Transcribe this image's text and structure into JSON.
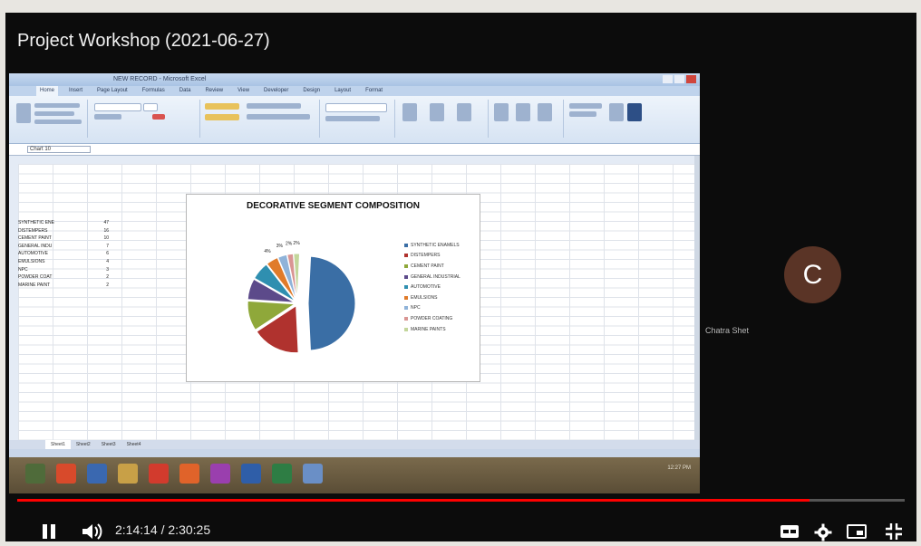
{
  "video": {
    "title": "Project Workshop (2021-06-27)",
    "time_current": "2:14:14",
    "time_separator": " / ",
    "time_total": "2:30:25",
    "progress_fraction": 0.893,
    "accent_color": "#ff0000"
  },
  "participant": {
    "initial": "C",
    "name": "Chatra Shet"
  },
  "excel": {
    "window_title": "NEW RECORD - Microsoft Excel",
    "ribbon_tabs": [
      "Home",
      "Insert",
      "Page Layout",
      "Formulas",
      "Data",
      "Review",
      "View",
      "Developer",
      "Design",
      "Layout",
      "Format"
    ],
    "active_tab": "Home",
    "name_box": "Chart 10",
    "rows": [
      {
        "label": "SYNTHETIC ENE",
        "value": "47"
      },
      {
        "label": "DISTEMPERS",
        "value": "16"
      },
      {
        "label": "CEMENT PAINT",
        "value": "10"
      },
      {
        "label": "GENERAL INDU",
        "value": "7"
      },
      {
        "label": "AUTOMOTIVE",
        "value": "6"
      },
      {
        "label": "EMULSIONS",
        "value": "4"
      },
      {
        "label": "NPC",
        "value": "3"
      },
      {
        "label": "POWDER COAT",
        "value": "2"
      },
      {
        "label": "MARINE PAINT",
        "value": "2"
      }
    ],
    "sheet_tabs": [
      "Sheet1",
      "Sheet2",
      "Sheet3",
      "Sheet4"
    ],
    "tray_time": "12:27 PM"
  },
  "chart_data": {
    "type": "pie",
    "title": "DECORATIVE SEGMENT COMPOSITION",
    "categories": [
      "SYNTHETIC ENAMELS",
      "DISTEMPERS",
      "CEMENT PAINT",
      "GENERAL INDUSTRIAL",
      "AUTOMOTIVE",
      "EMULSIONS",
      "NPC",
      "POWDER COATING",
      "MARINE PAINTS"
    ],
    "values": [
      47,
      16,
      10,
      7,
      6,
      4,
      3,
      2,
      2
    ],
    "colors": [
      "#3a6ea5",
      "#b0322e",
      "#8fa83a",
      "#5c4a8a",
      "#2f8fb0",
      "#e07b2a",
      "#8fb3d9",
      "#d99593",
      "#c3d69b"
    ],
    "data_labels": [
      "",
      "",
      "",
      "",
      "",
      "4%",
      "3%",
      "2%",
      "2%"
    ],
    "legend_position": "right"
  }
}
